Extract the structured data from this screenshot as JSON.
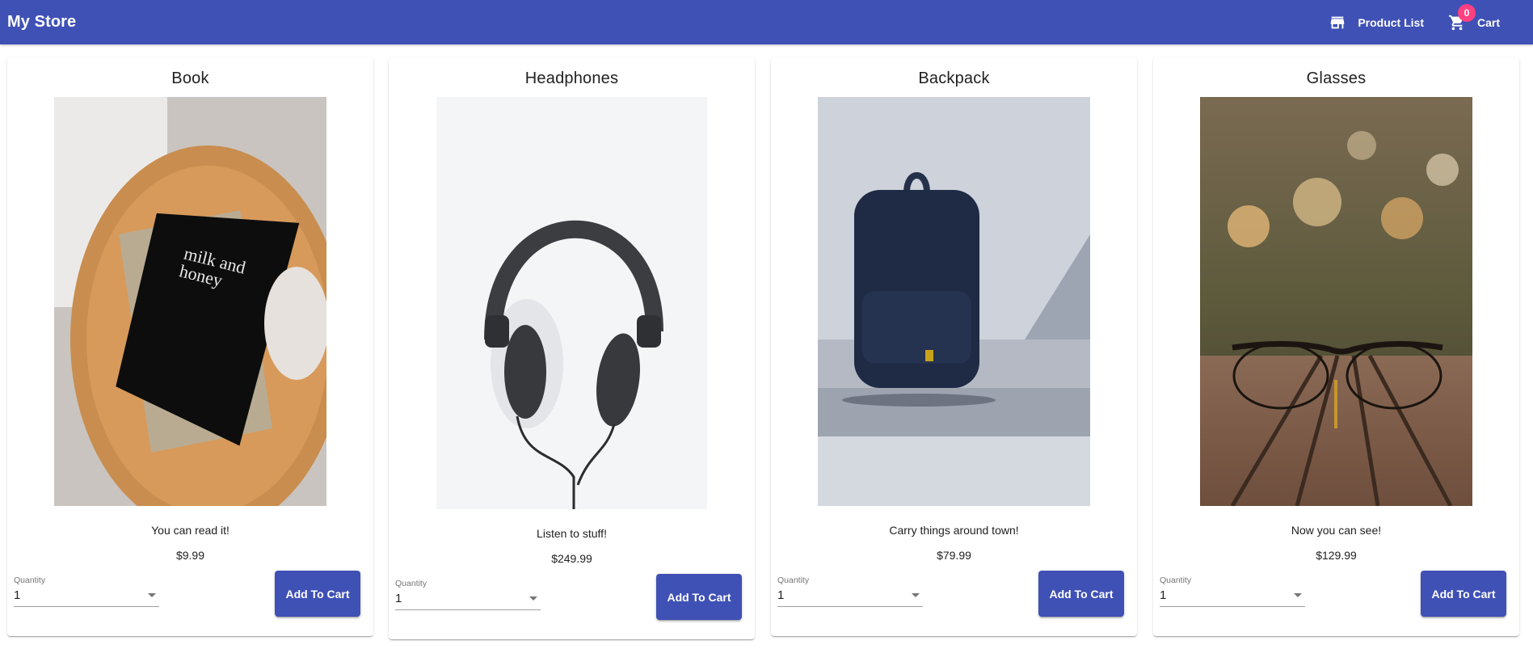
{
  "app": {
    "brand": "My Store",
    "nav": {
      "product_list_label": "Product List",
      "product_list_icon": "storefront-icon",
      "cart_label": "Cart",
      "cart_icon": "shopping-cart-icon",
      "cart_count": "0"
    },
    "colors": {
      "primary": "#3f51b5",
      "badge": "#ff4081"
    }
  },
  "products": [
    {
      "title": "Book",
      "image": "book-photo",
      "description": "You can read it!",
      "price": "$9.99",
      "quantity_label": "Quantity",
      "quantity": "1",
      "add_label": "Add To Cart"
    },
    {
      "title": "Headphones",
      "image": "headphones-photo",
      "description": "Listen to stuff!",
      "price": "$249.99",
      "quantity_label": "Quantity",
      "quantity": "1",
      "add_label": "Add To Cart"
    },
    {
      "title": "Backpack",
      "image": "backpack-photo",
      "description": "Carry things around town!",
      "price": "$79.99",
      "quantity_label": "Quantity",
      "quantity": "1",
      "add_label": "Add To Cart"
    },
    {
      "title": "Glasses",
      "image": "glasses-photo",
      "description": "Now you can see!",
      "price": "$129.99",
      "quantity_label": "Quantity",
      "quantity": "1",
      "add_label": "Add To Cart"
    }
  ]
}
